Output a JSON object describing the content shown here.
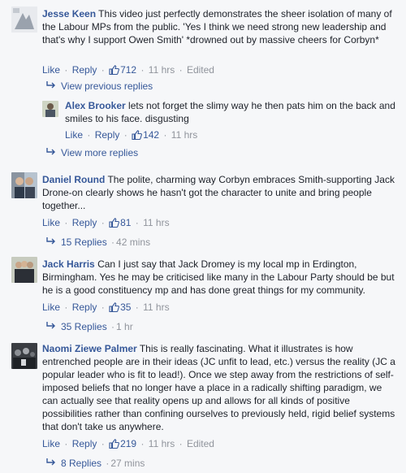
{
  "labels": {
    "like": "Like",
    "reply": "Reply",
    "sep": "·"
  },
  "comments": [
    {
      "author": "Jesse Keen",
      "text": "This video just perfectly demonstrates the sheer isolation of many of the Labour MPs from the public. 'Yes I think we need strong new leadership and that's why I support Owen Smith' *drowned out by massive cheers for Corbyn*",
      "likes": "712",
      "time": "11 hrs",
      "edited": "Edited"
    },
    {
      "author": "Alex Brooker",
      "text": "lets not forget the slimy way he then pats him on the back and smiles to his face. disgusting",
      "likes": "142",
      "time": "11 hrs"
    },
    {
      "author": "Daniel Round",
      "text": "The polite, charming way Corbyn embraces Smith-supporting Jack Drone-on clearly shows he hasn't got the character to unite and bring people together...",
      "likes": "81",
      "time": "11 hrs",
      "replies": "15 Replies",
      "replies_time": "42 mins"
    },
    {
      "author": "Jack Harris",
      "text": "Can I just say that Jack Dromey is my local mp in Erdington, Birmingham. Yes he may be criticised like many in the Labour Party should be but he is a good constituency mp and has done great things for my community.",
      "likes": "35",
      "time": "11 hrs",
      "replies": "35 Replies",
      "replies_time": "1 hr"
    },
    {
      "author": "Naomi Ziewe Palmer",
      "text": "This is really fascinating. What it illustrates is how entrenched people are in their ideas (JC unfit to lead, etc.) versus the reality (JC a popular leader who is fit to lead!). Once we step away from the restrictions of self-imposed beliefs that no longer have a place in a radically shifting paradigm, we can actually see that reality opens up and allows for all kinds of positive possibilities rather than confining ourselves to previously held, rigid belief systems that don't take us anywhere.",
      "likes": "219",
      "time": "11 hrs",
      "edited": "Edited",
      "replies": "8 Replies",
      "replies_time": "27 mins"
    }
  ],
  "view_previous": "View previous replies",
  "view_more": "View more replies",
  "colors": {
    "link": "#365899",
    "meta": "#90949c",
    "background": "#f6f7f9"
  }
}
